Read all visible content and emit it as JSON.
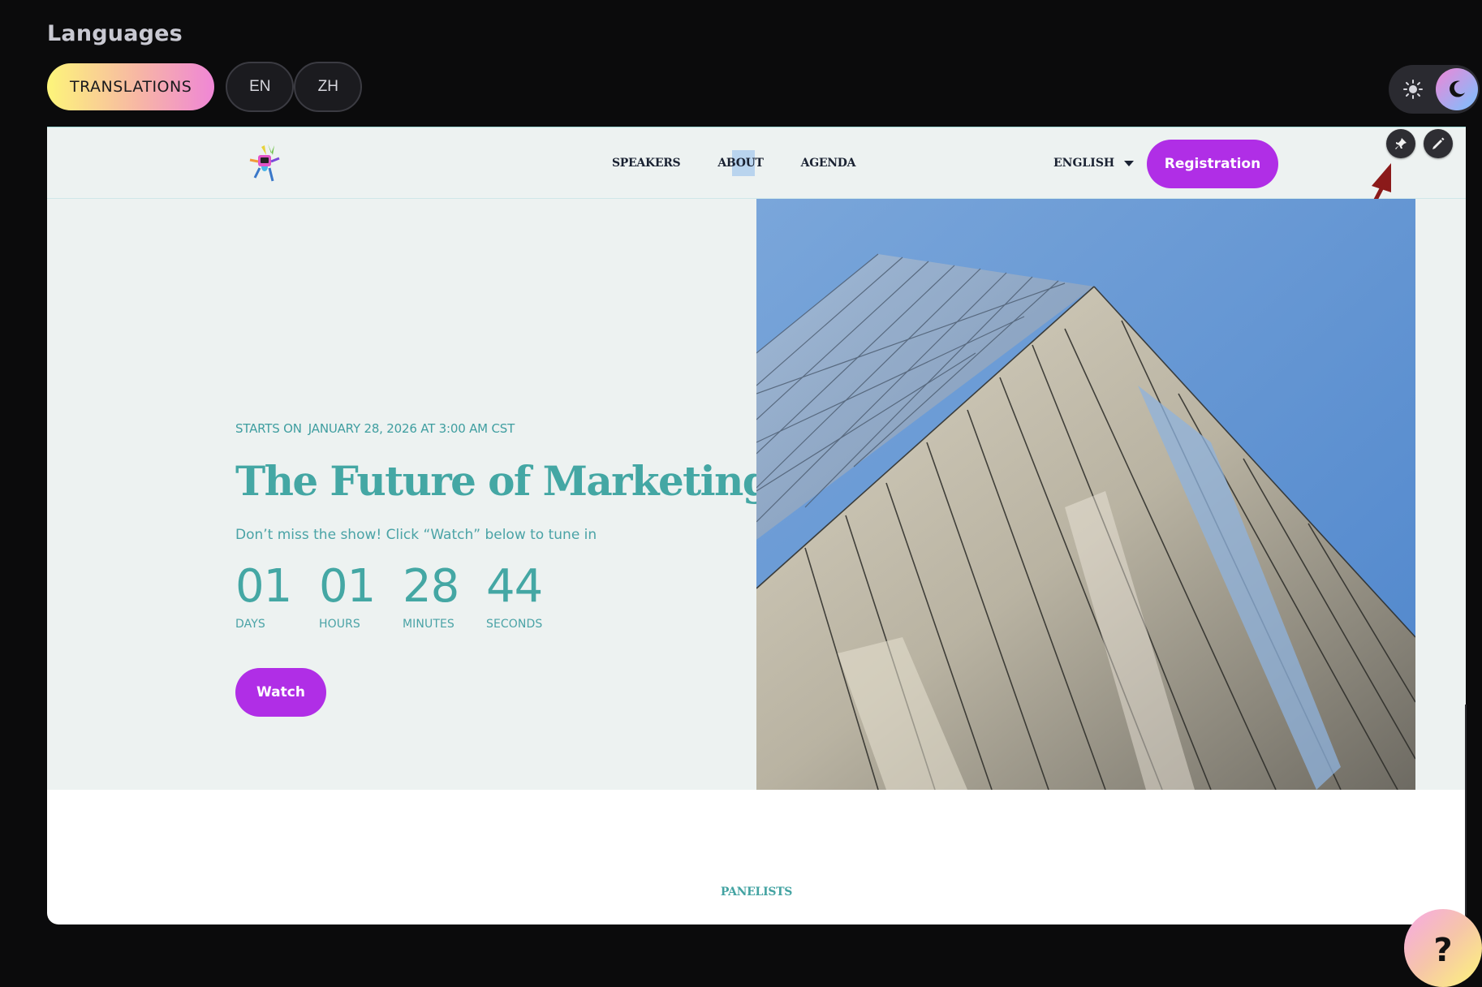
{
  "app": {
    "section_title": "Languages",
    "translations_label": "TRANSLATIONS",
    "languages": [
      "EN",
      "ZH"
    ]
  },
  "theme": {
    "current": "dark",
    "sun_icon": "sun-icon",
    "moon_icon": "moon-icon"
  },
  "site": {
    "nav": {
      "items": [
        "SPEAKERS",
        "ABOUT",
        "AGENDA"
      ]
    },
    "language_select": "ENGLISH",
    "registration_label": "Registration",
    "tools": [
      "pin-icon",
      "pencil-icon"
    ]
  },
  "hero": {
    "starts_on_label": "STARTS ON",
    "starts_on_value": "JANUARY 28, 2026 AT 3:00 AM CST",
    "title": "The Future of Marketing",
    "subtitle": "Don’t miss the show! Click “Watch” below to tune in",
    "countdown": [
      {
        "value": "01",
        "label": "DAYS"
      },
      {
        "value": "01",
        "label": "HOURS"
      },
      {
        "value": "28",
        "label": "MINUTES"
      },
      {
        "value": "44",
        "label": "SECONDS"
      }
    ],
    "watch_label": "Watch"
  },
  "panelists_label": "PANELISTS",
  "help_label": "?",
  "colors": {
    "accent_purple": "#b02ee6",
    "teal": "#44a7a4",
    "hero_bg": "#edf2f1",
    "app_bg": "#0b0b0c",
    "arrow": "#8b1a1a"
  }
}
